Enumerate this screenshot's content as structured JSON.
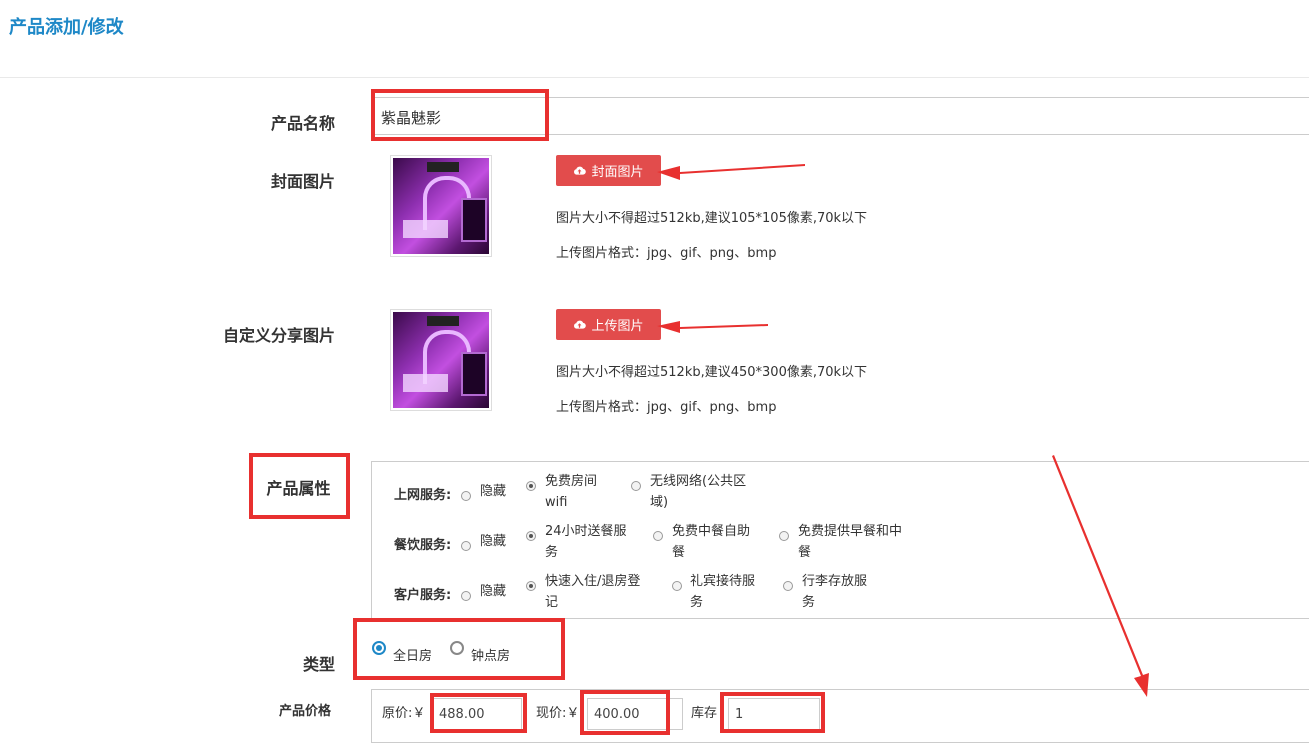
{
  "header": {
    "title": "产品添加/修改"
  },
  "form": {
    "name_label": "产品名称",
    "name_value": "紫晶魅影",
    "cover": {
      "label": "封面图片",
      "button": "封面图片",
      "hint_size": "图片大小不得超过512kb,建议105*105像素,70k以下",
      "hint_format": "上传图片格式：jpg、gif、png、bmp"
    },
    "share": {
      "label": "自定义分享图片",
      "button": "上传图片",
      "hint_size": "图片大小不得超过512kb,建议450*300像素,70k以下",
      "hint_format": "上传图片格式：jpg、gif、png、bmp"
    },
    "attributes": {
      "label": "产品属性",
      "groups": [
        {
          "name": "上网服务:",
          "options": [
            {
              "line1": "隐藏",
              "line2": "",
              "checked": false
            },
            {
              "line1": "免费房间",
              "line2": "wifi",
              "checked": true
            },
            {
              "line1": "无线网络(公共区",
              "line2": "域)",
              "checked": false
            }
          ]
        },
        {
          "name": "餐饮服务:",
          "options": [
            {
              "line1": "隐藏",
              "line2": "",
              "checked": false
            },
            {
              "line1": "24小时送餐服",
              "line2": "务",
              "checked": true
            },
            {
              "line1": "免费中餐自助",
              "line2": "餐",
              "checked": false
            },
            {
              "line1": "免费提供早餐和中",
              "line2": "餐",
              "checked": false
            }
          ]
        },
        {
          "name": "客户服务:",
          "options": [
            {
              "line1": "隐藏",
              "line2": "",
              "checked": false
            },
            {
              "line1": "快速入住/退房登",
              "line2": "记",
              "checked": true
            },
            {
              "line1": "礼宾接待服",
              "line2": "务",
              "checked": false
            },
            {
              "line1": "行李存放服",
              "line2": "务",
              "checked": false
            }
          ]
        }
      ]
    },
    "type": {
      "label": "类型",
      "options": [
        {
          "label": "全日房",
          "checked": true
        },
        {
          "label": "钟点房",
          "checked": false
        }
      ]
    },
    "price": {
      "label": "产品价格",
      "original_label": "原价:￥",
      "original_value": "488.00",
      "current_label": "现价:￥",
      "current_value": "400.00",
      "stock_label": "库存",
      "stock_value": "1"
    }
  },
  "colors": {
    "accent": "#1e88c7",
    "button_red": "#e24c4c",
    "annotation_red": "#e8302f"
  }
}
